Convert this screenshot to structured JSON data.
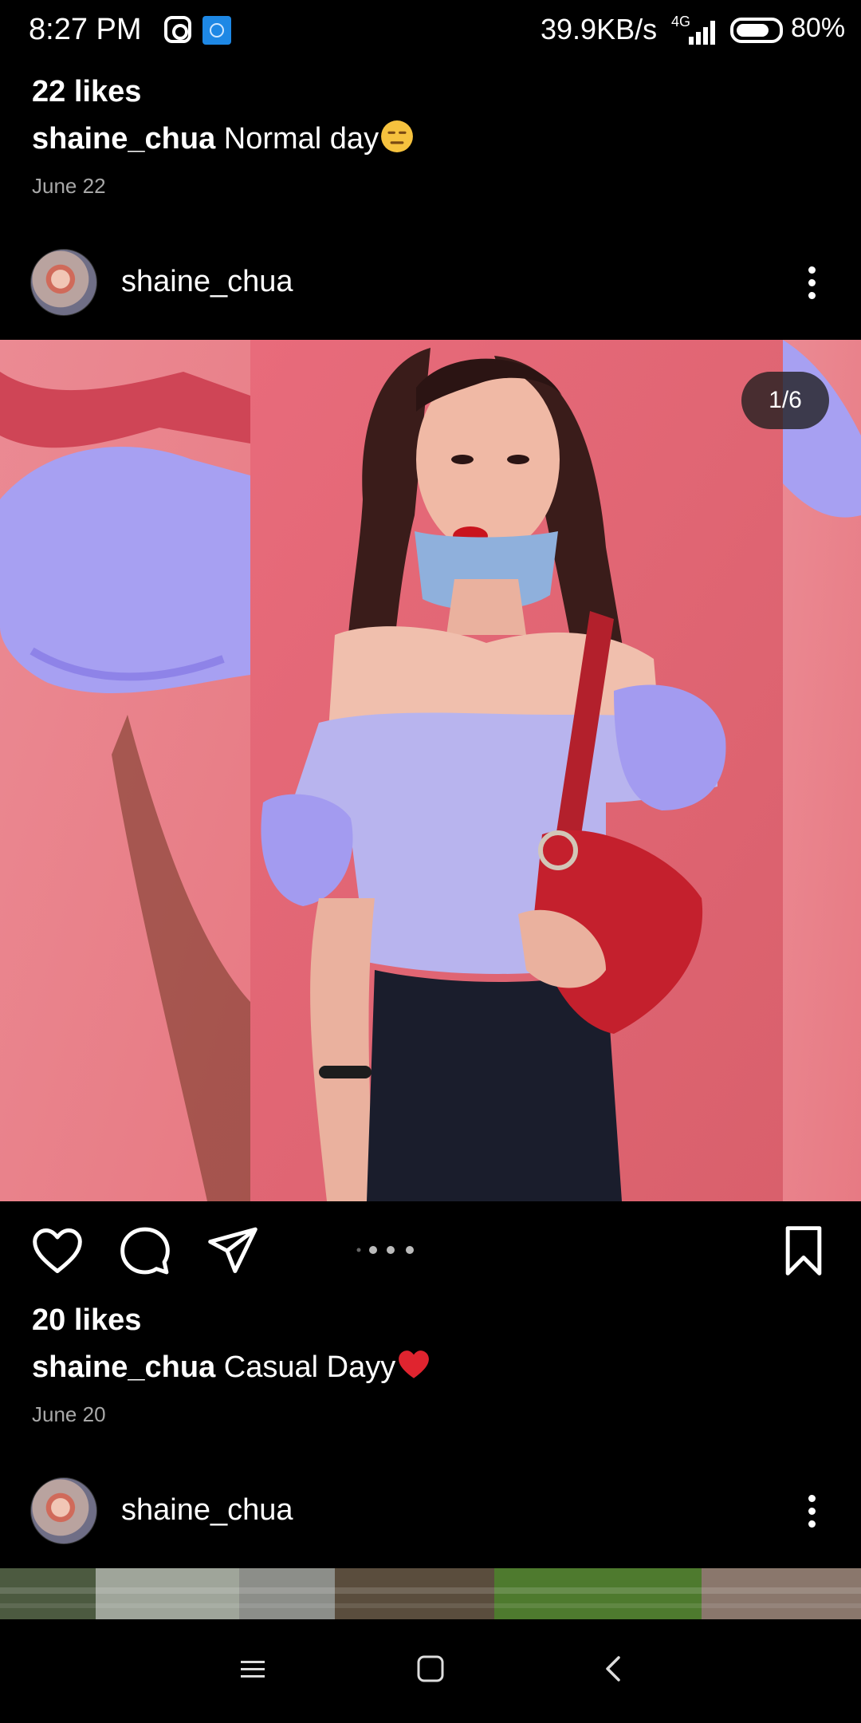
{
  "status_bar": {
    "time": "8:27 PM",
    "network_speed": "39.9KB/s",
    "network_type": "4G",
    "battery": "80%",
    "battery_level": 0.8,
    "icons": [
      "instagram-icon",
      "app-notification-icon",
      "signal-icon",
      "battery-icon"
    ]
  },
  "previous_post": {
    "likes": "22 likes",
    "username": "shaine_chua",
    "caption": "Normal day",
    "emoji": "expressionless-face-emoji",
    "date": "June 22"
  },
  "current_post": {
    "username": "shaine_chua",
    "image_counter": "1/6",
    "carousel_position": 1,
    "carousel_total": 6,
    "likes": "20 likes",
    "caption": "Casual Dayy",
    "emoji": "red-heart-emoji",
    "date": "June 20",
    "actions": [
      "heart-icon",
      "comment-icon",
      "share-icon",
      "bookmark-icon"
    ]
  },
  "next_post": {
    "username": "shaine_chua"
  },
  "nav_bar": {
    "buttons": [
      "menu-icon",
      "home-icon",
      "back-icon"
    ]
  },
  "colors": {
    "background": "#000000",
    "text": "#ffffff",
    "secondary_text": "#a8a8a8",
    "photo_background": "#e0727a",
    "top_color": "#b8b4ee"
  }
}
